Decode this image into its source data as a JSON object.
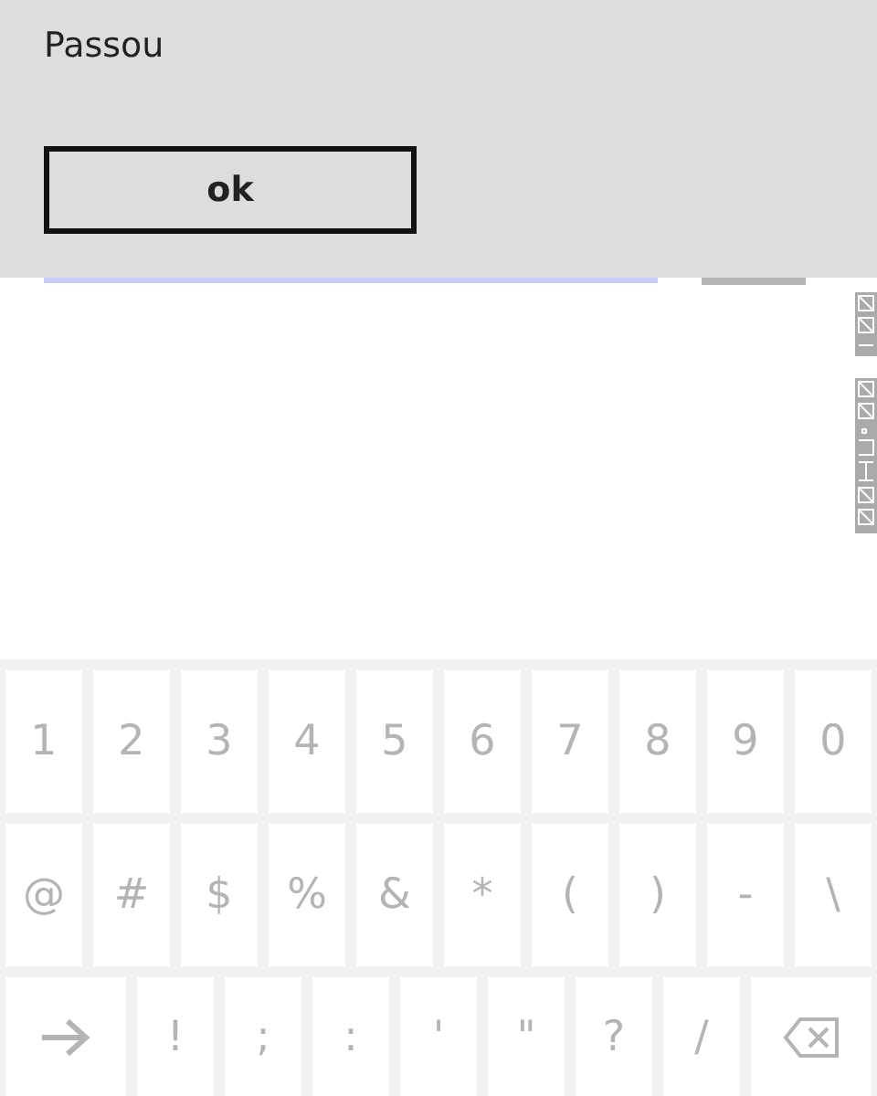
{
  "dialog": {
    "message": "Passou",
    "button": "ok"
  },
  "keyboard": {
    "rows": [
      [
        {
          "kind": "char",
          "label": "1"
        },
        {
          "kind": "char",
          "label": "2"
        },
        {
          "kind": "char",
          "label": "3"
        },
        {
          "kind": "char",
          "label": "4"
        },
        {
          "kind": "char",
          "label": "5"
        },
        {
          "kind": "char",
          "label": "6"
        },
        {
          "kind": "char",
          "label": "7"
        },
        {
          "kind": "char",
          "label": "8"
        },
        {
          "kind": "char",
          "label": "9"
        },
        {
          "kind": "char",
          "label": "0"
        }
      ],
      [
        {
          "kind": "char",
          "label": "@"
        },
        {
          "kind": "char",
          "label": "#"
        },
        {
          "kind": "char",
          "label": "$"
        },
        {
          "kind": "char",
          "label": "%"
        },
        {
          "kind": "char",
          "label": "&"
        },
        {
          "kind": "char",
          "label": "*"
        },
        {
          "kind": "char",
          "label": "("
        },
        {
          "kind": "char",
          "label": ")"
        },
        {
          "kind": "char",
          "label": "-"
        },
        {
          "kind": "char",
          "label": "\\"
        }
      ],
      [
        {
          "kind": "enter"
        },
        {
          "kind": "char",
          "label": "!"
        },
        {
          "kind": "char",
          "label": ";"
        },
        {
          "kind": "char",
          "label": ":"
        },
        {
          "kind": "char",
          "label": "'"
        },
        {
          "kind": "char",
          "label": "\""
        },
        {
          "kind": "char",
          "label": "?"
        },
        {
          "kind": "char",
          "label": "/"
        },
        {
          "kind": "backspace"
        }
      ]
    ]
  }
}
